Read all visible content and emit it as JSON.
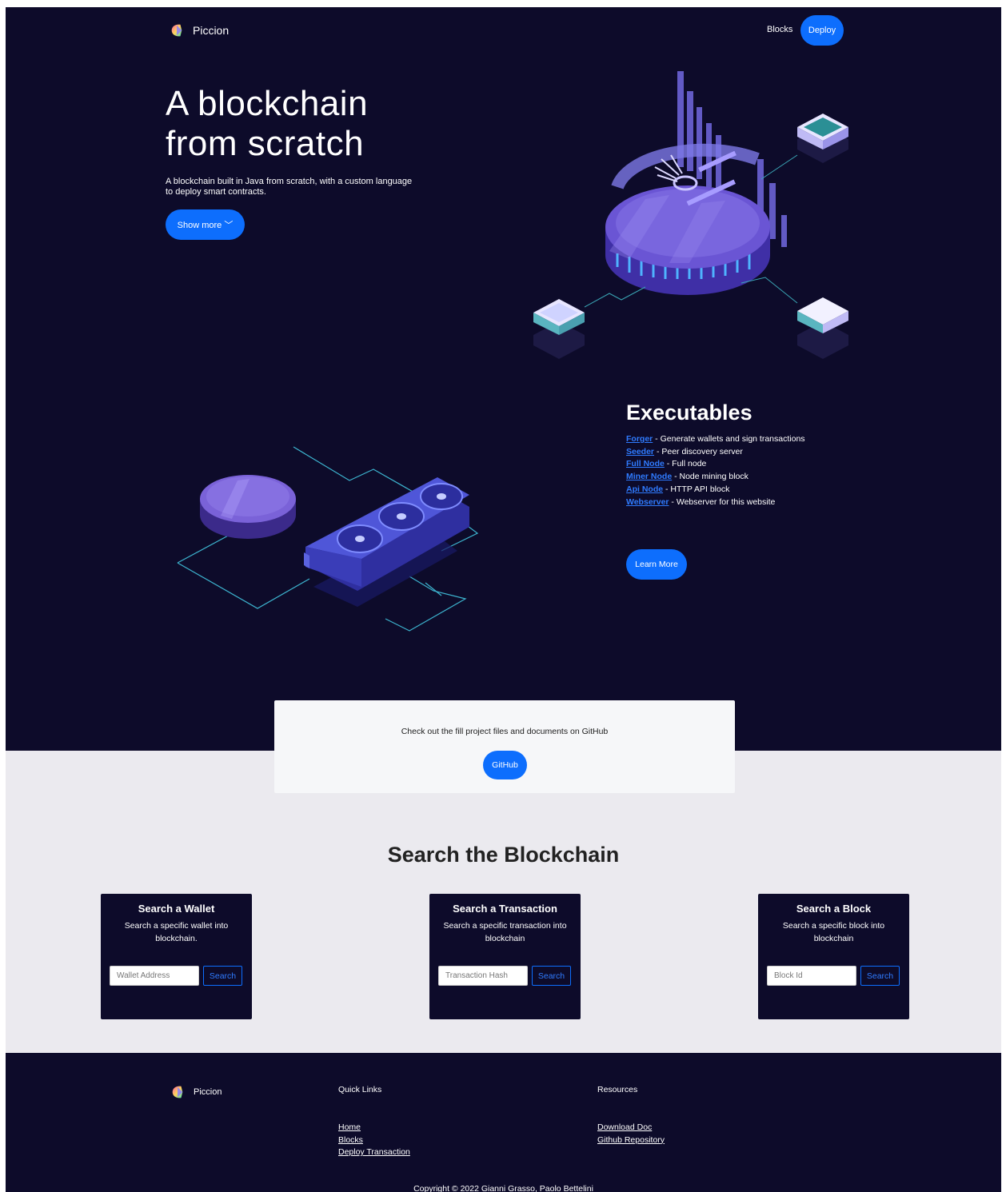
{
  "nav": {
    "brand": "Piccion",
    "blocks_link": "Blocks",
    "deploy_button": "Deploy"
  },
  "hero": {
    "title_line1": "A blockchain",
    "title_line2": "from scratch",
    "subtitle": "A blockchain built in Java from scratch, with a custom language to deploy smart contracts.",
    "show_more_button": "Show more ﹀"
  },
  "executables": {
    "title": "Executables",
    "items": [
      {
        "name": "Forger",
        "desc": " - Generate wallets and sign transactions"
      },
      {
        "name": "Seeder",
        "desc": " - Peer discovery server"
      },
      {
        "name": "Full Node",
        "desc": " - Full node"
      },
      {
        "name": "Miner Node",
        "desc": " - Node mining block"
      },
      {
        "name": "Api Node",
        "desc": " - HTTP API block"
      },
      {
        "name": "Webserver",
        "desc": " - Webserver for this website"
      }
    ],
    "learn_more_button": "Learn More"
  },
  "github": {
    "text": "Check out the fill project files and documents on GitHub",
    "button": "GitHub"
  },
  "search": {
    "title": "Search the Blockchain",
    "cards": [
      {
        "title": "Search a Wallet",
        "desc": "Search a specific wallet into blockchain.",
        "placeholder": "Wallet Address",
        "button": "Search"
      },
      {
        "title": "Search a Transaction",
        "desc": "Search a specific transaction into blockchain",
        "placeholder": "Transaction Hash",
        "button": "Search"
      },
      {
        "title": "Search a Block",
        "desc": "Search a specific block into blockchain",
        "placeholder": "Block Id",
        "button": "Search"
      }
    ]
  },
  "footer": {
    "brand": "Piccion",
    "quick_links_title": "Quick Links",
    "quick_links": [
      "Home",
      "Blocks",
      "Deploy Transaction"
    ],
    "resources_title": "Resources",
    "resources": [
      "Download Doc",
      "Github Repository"
    ],
    "copyright": "Copyright © 2022 Gianni Grasso, Paolo Bettelini"
  },
  "colors": {
    "navy": "#0d0b2a",
    "accent": "#0d6efd",
    "link": "#2f7bff",
    "light_section": "#ebeaef"
  }
}
